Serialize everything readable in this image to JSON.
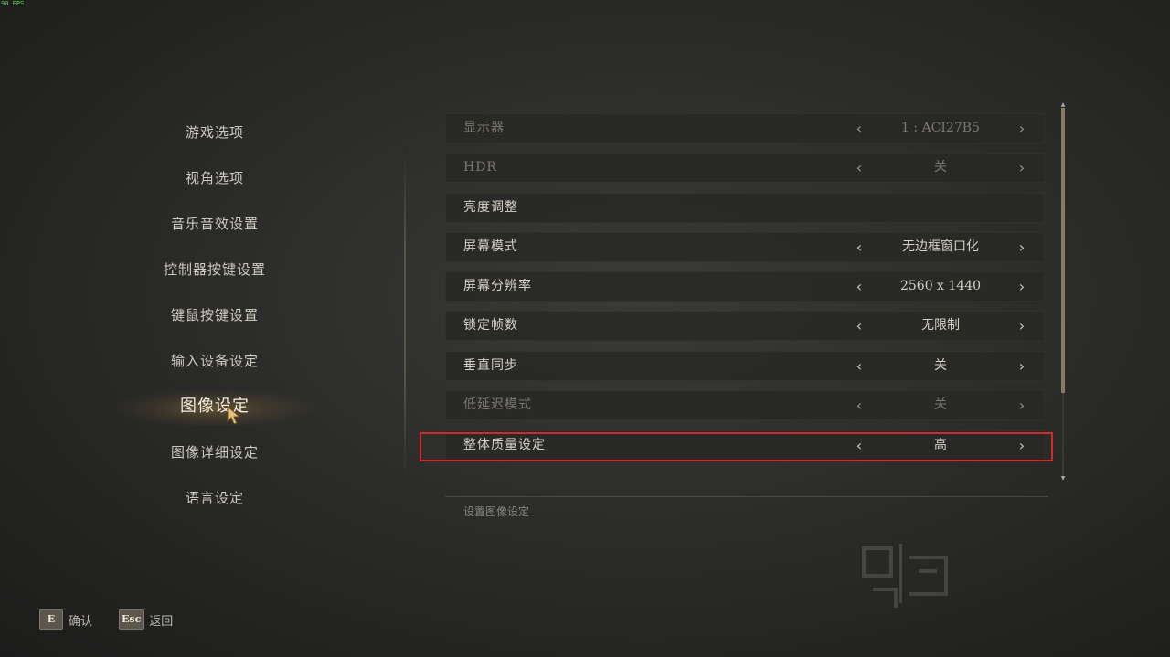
{
  "fps": "90 FPS",
  "menu": {
    "items": [
      {
        "label": "游戏选项"
      },
      {
        "label": "视角选项"
      },
      {
        "label": "音乐音效设置"
      },
      {
        "label": "控制器按键设置"
      },
      {
        "label": "键鼠按键设置"
      },
      {
        "label": "输入设备设定"
      },
      {
        "label": "图像设定",
        "active": true
      },
      {
        "label": "图像详细设定"
      },
      {
        "label": "语言设定"
      }
    ]
  },
  "settings": {
    "rows": [
      {
        "label": "显示器",
        "value": "1 : ACI27B5",
        "dim": true
      },
      {
        "label": "HDR",
        "value": "关",
        "dim": true
      },
      {
        "label": "亮度调整",
        "value": null
      },
      {
        "label": "屏幕模式",
        "value": "无边框窗口化"
      },
      {
        "label": "屏幕分辨率",
        "value": "2560 x 1440"
      },
      {
        "label": "锁定帧数",
        "value": "无限制"
      },
      {
        "label": "垂直同步",
        "value": "关"
      },
      {
        "label": "低延迟模式",
        "value": "关",
        "dim": true
      },
      {
        "label": "整体质量设定",
        "value": "高",
        "selected": true
      }
    ],
    "arrow_left": "‹",
    "arrow_right": "›"
  },
  "description": "设置图像设定",
  "footer": {
    "confirm": {
      "key": "E",
      "label": "确认"
    },
    "back": {
      "key": "Esc",
      "label": "返回"
    }
  },
  "colors": {
    "highlight": "#d02a2a",
    "accent_glow": "#c89646"
  }
}
